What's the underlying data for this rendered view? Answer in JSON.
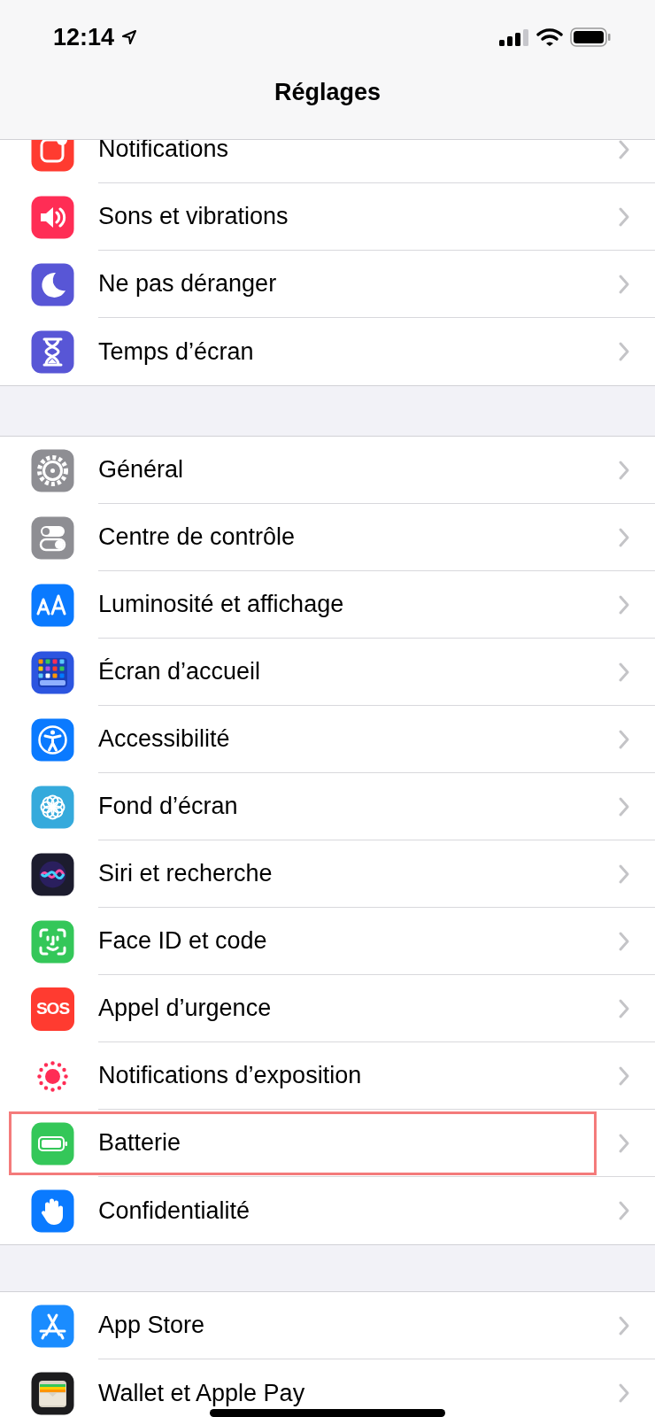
{
  "status_bar": {
    "time": "12:14"
  },
  "title": "Réglages",
  "groups": [
    {
      "items": [
        {
          "label": "Notifications",
          "kind": "notifications",
          "color": "#ff3b30",
          "highlighted": false
        },
        {
          "label": "Sons et vibrations",
          "kind": "sound",
          "color": "#ff2d55",
          "highlighted": false
        },
        {
          "label": "Ne pas déranger",
          "kind": "moon",
          "color": "#5856d6",
          "highlighted": false
        },
        {
          "label": "Temps d’écran",
          "kind": "hourglass",
          "color": "#5856d6",
          "highlighted": false
        }
      ]
    },
    {
      "items": [
        {
          "label": "Général",
          "kind": "gear",
          "color": "#8e8e93",
          "highlighted": false
        },
        {
          "label": "Centre de contrôle",
          "kind": "toggles",
          "color": "#8e8e93",
          "highlighted": false
        },
        {
          "label": "Luminosité et affichage",
          "kind": "letters",
          "color": "#0a7aff",
          "highlighted": false
        },
        {
          "label": "Écran d’accueil",
          "kind": "grid",
          "color": "#2c55e0",
          "highlighted": false
        },
        {
          "label": "Accessibilité",
          "kind": "accessibility",
          "color": "#0a7aff",
          "highlighted": false
        },
        {
          "label": "Fond d’écran",
          "kind": "flower",
          "color": "#35aadc",
          "highlighted": false
        },
        {
          "label": "Siri et recherche",
          "kind": "siri",
          "color": "#1c1c2e",
          "highlighted": false
        },
        {
          "label": "Face ID et code",
          "kind": "face",
          "color": "#34c759",
          "highlighted": false
        },
        {
          "label": "Appel d’urgence",
          "kind": "sos",
          "color": "#ff3b30",
          "icon_text": "SOS",
          "highlighted": false
        },
        {
          "label": "Notifications d’exposition",
          "kind": "exposure",
          "color": "#ffffff",
          "highlighted": false
        },
        {
          "label": "Batterie",
          "kind": "battery",
          "color": "#34c759",
          "highlighted": true
        },
        {
          "label": "Confidentialité",
          "kind": "hand",
          "color": "#0a7aff",
          "highlighted": false
        }
      ]
    },
    {
      "items": [
        {
          "label": "App Store",
          "kind": "appstore",
          "color": "#1a8cff",
          "highlighted": false
        },
        {
          "label": "Wallet et Apple Pay",
          "kind": "wallet",
          "color": "#1c1c1e",
          "highlighted": false
        }
      ]
    }
  ]
}
